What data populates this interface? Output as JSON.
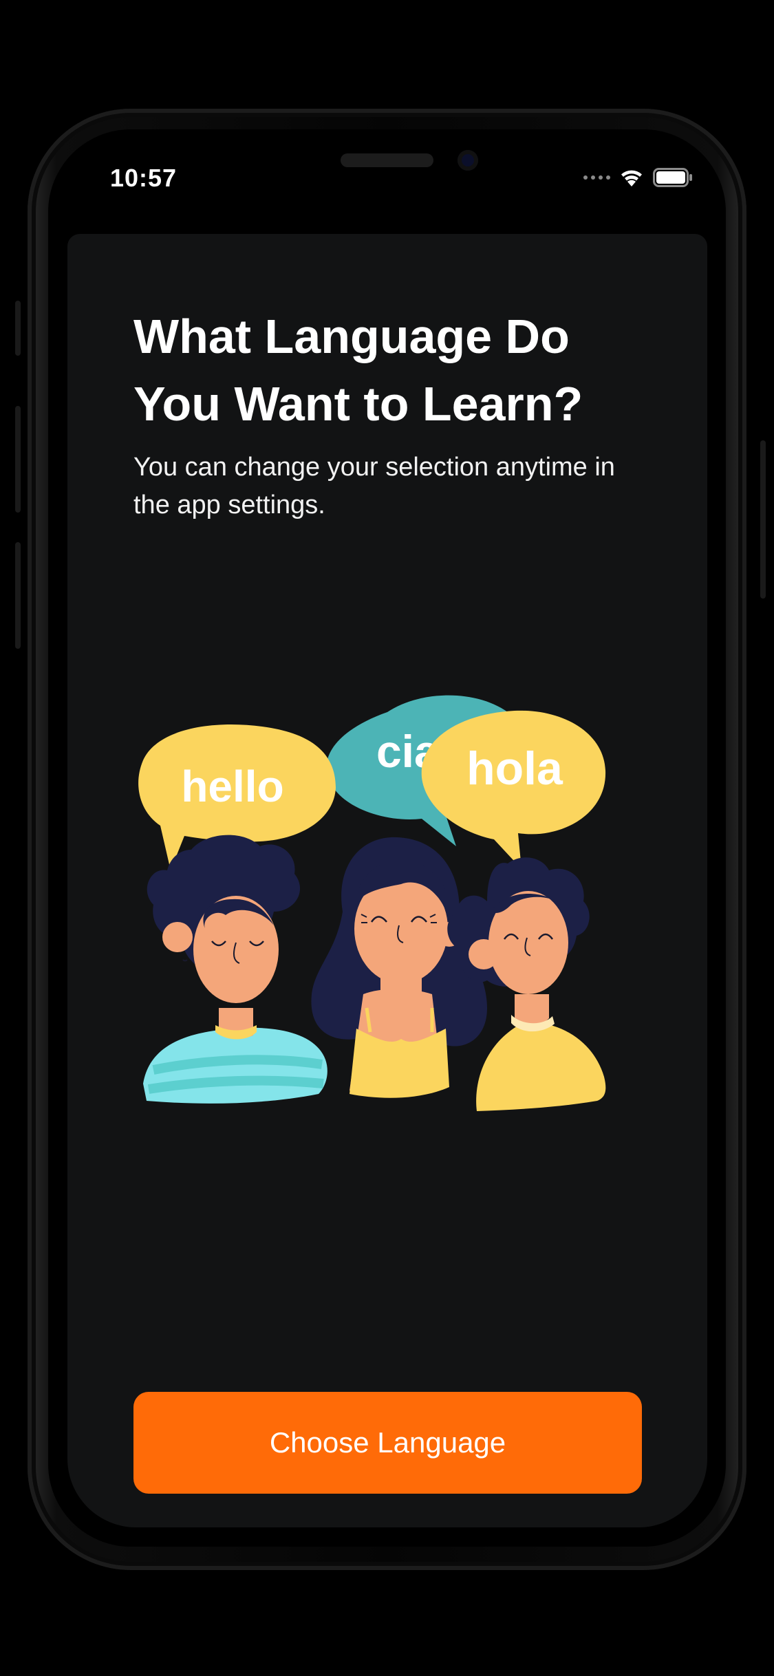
{
  "status_bar": {
    "time": "10:57",
    "icons": [
      "cellular-signal-icon",
      "wifi-icon",
      "battery-icon"
    ]
  },
  "onboarding": {
    "title": "What Language Do You Want to Learn?",
    "subtitle": "You can change your selection anytime in the app settings.",
    "illustration": {
      "bubbles": [
        "hello",
        "ciao",
        "hola"
      ]
    },
    "primary_button": "Choose Language"
  },
  "colors": {
    "accent": "#ff6b08",
    "background": "#121314",
    "bubble_yellow": "#fbd55e",
    "bubble_teal": "#4cb4b6",
    "hair_navy": "#1c2046",
    "skin": "#f4a67a"
  }
}
